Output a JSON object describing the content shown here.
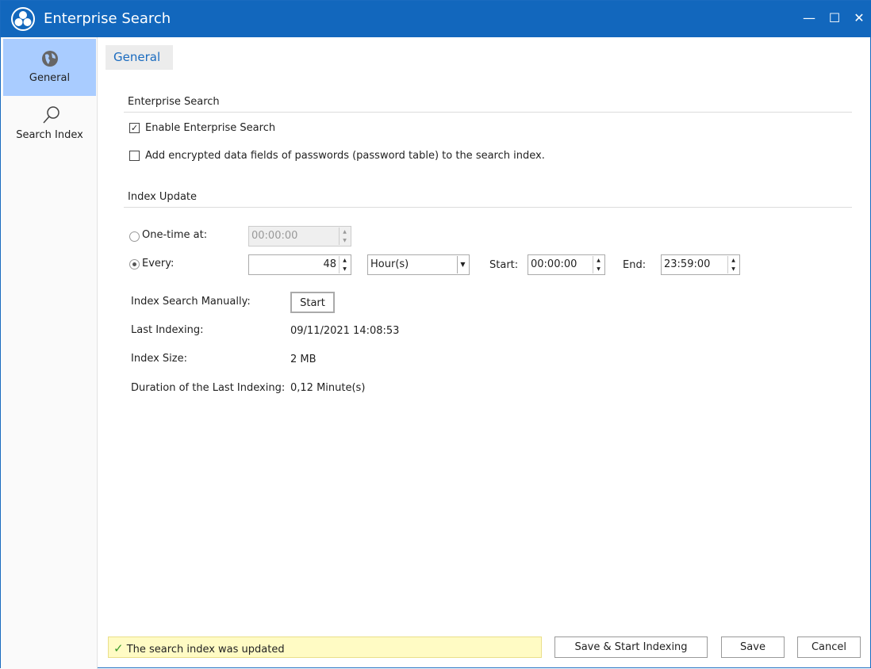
{
  "window": {
    "title": "Enterprise Search",
    "minimize": "—",
    "maximize": "☐",
    "close": "✕"
  },
  "sidebar": {
    "items": [
      {
        "label": "General",
        "icon": "globe-icon",
        "selected": true
      },
      {
        "label": "Search Index",
        "icon": "search-icon",
        "selected": false
      }
    ]
  },
  "tab": {
    "label": "General"
  },
  "enterprise": {
    "heading": "Enterprise Search",
    "enable_label": "Enable Enterprise Search",
    "enable_checked": true,
    "encrypt_label": "Add encrypted data fields of passwords (password table) to the search index.",
    "encrypt_checked": false
  },
  "index_update": {
    "heading": "Index Update",
    "onetime_label": "One-time at:",
    "onetime_value": "00:00:00",
    "every_label": "Every:",
    "every_value": "48",
    "unit": "Hour(s)",
    "start_label": "Start:",
    "start_value": "00:00:00",
    "end_label": "End:",
    "end_value": "23:59:00",
    "selected": "every"
  },
  "info": {
    "manual_label": "Index Search Manually:",
    "start_button": "Start",
    "last_label": "Last Indexing:",
    "last_value": "09/11/2021 14:08:53",
    "size_label": "Index Size:",
    "size_value": "2 MB",
    "duration_label": "Duration of the Last Indexing:",
    "duration_value": "0,12 Minute(s)"
  },
  "footer": {
    "status": "The search index was updated",
    "save_start": "Save & Start Indexing",
    "save": "Save",
    "cancel": "Cancel"
  }
}
